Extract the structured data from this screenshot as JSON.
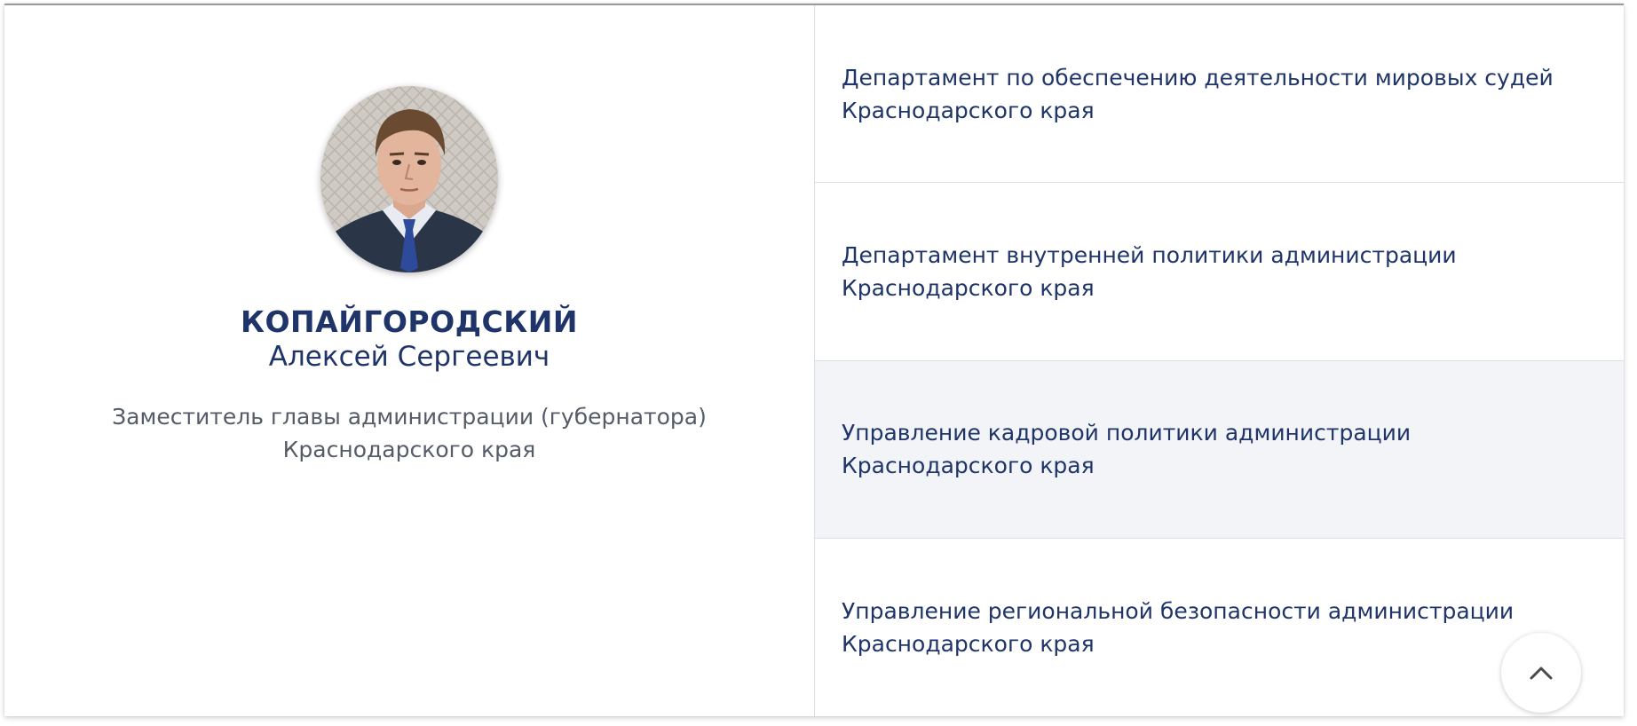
{
  "official": {
    "photo_icon": "portrait-photo",
    "surname": "КОПАЙГОРОДСКИЙ",
    "given_names": "Алексей Сергеевич",
    "position": "Заместитель главы администрации (губернатора) Краснодарского края"
  },
  "departments": [
    {
      "label": "Департамент по обеспечению деятельности мировых судей Краснодарского края",
      "active": false
    },
    {
      "label": "Департамент внутренней политики администрации Краснодарского края",
      "active": false
    },
    {
      "label": "Управление кадровой политики администрации Краснодарского края",
      "active": true
    },
    {
      "label": "Управление региональной безопасности администрации Краснодарского края",
      "active": false
    }
  ],
  "scroll_top": {
    "icon": "chevron-up-icon"
  },
  "colors": {
    "accent": "#1f3468",
    "muted_text": "#555c68",
    "active_row_bg": "#f2f4f8",
    "divider": "#dcdfe8"
  }
}
